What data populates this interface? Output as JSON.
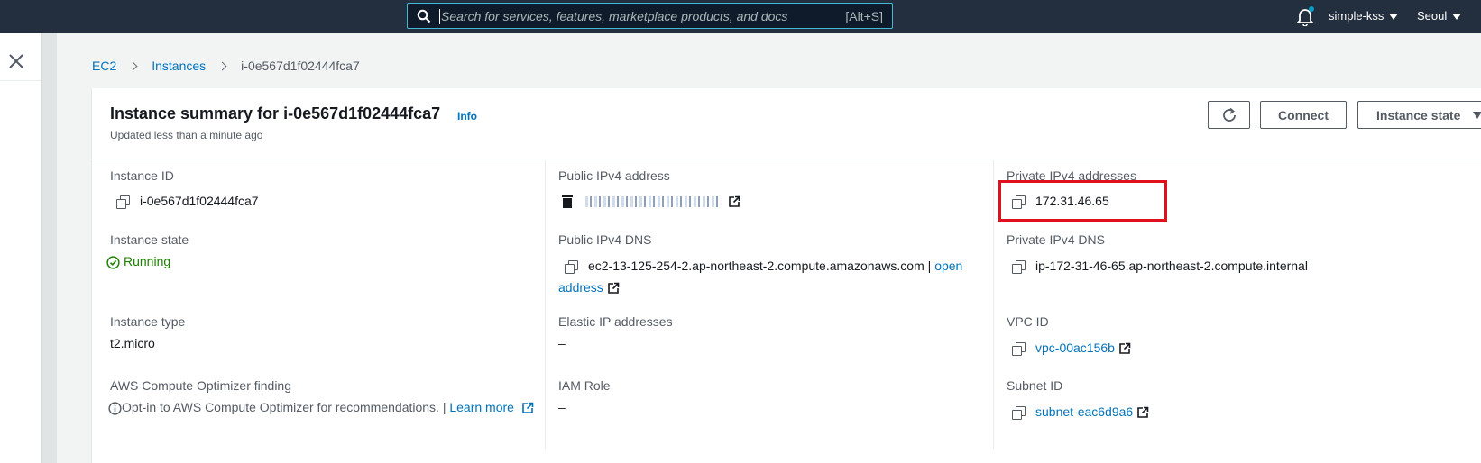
{
  "search": {
    "placeholder": "Search for services, features, marketplace products, and docs",
    "shortcut": "[Alt+S]"
  },
  "nav": {
    "account": "simple-kss",
    "region": "Seoul"
  },
  "breadcrumb": {
    "root": "EC2",
    "section": "Instances",
    "current": "i-0e567d1f02444fca7"
  },
  "summary": {
    "title": "Instance summary for i-0e567d1f02444fca7",
    "info_label": "Info",
    "updated": "Updated less than a minute ago",
    "buttons": {
      "connect": "Connect",
      "instance_state": "Instance state"
    }
  },
  "details": {
    "instance_id": {
      "label": "Instance ID",
      "value": "i-0e567d1f02444fca7"
    },
    "public_ipv4": {
      "label": "Public IPv4 address"
    },
    "private_ipv4": {
      "label": "Private IPv4 addresses",
      "value": "172.31.46.65"
    },
    "instance_state": {
      "label": "Instance state",
      "value": "Running"
    },
    "public_dns": {
      "label": "Public IPv4 DNS",
      "value": "ec2-13-125-254-2.ap-northeast-2.compute.amazonaws.com",
      "separator": "|",
      "link_part1": "open",
      "link_part2": "address"
    },
    "private_dns": {
      "label": "Private IPv4 DNS",
      "value": "ip-172-31-46-65.ap-northeast-2.compute.internal"
    },
    "instance_type": {
      "label": "Instance type",
      "value": "t2.micro"
    },
    "elastic_ip": {
      "label": "Elastic IP addresses",
      "value": "–"
    },
    "vpc_id": {
      "label": "VPC ID",
      "value": "vpc-00ac156b"
    },
    "optimizer": {
      "label": "AWS Compute Optimizer finding",
      "value": "Opt-in to AWS Compute Optimizer for recommendations. |",
      "link": "Learn more"
    },
    "iam_role": {
      "label": "IAM Role",
      "value": "–"
    },
    "subnet_id": {
      "label": "Subnet ID",
      "value": "subnet-eac6d9a6"
    }
  },
  "colors": {
    "nav_bg": "#232f3e",
    "link": "#0073bb",
    "running": "#1d8102",
    "highlight": "#e0111c"
  }
}
